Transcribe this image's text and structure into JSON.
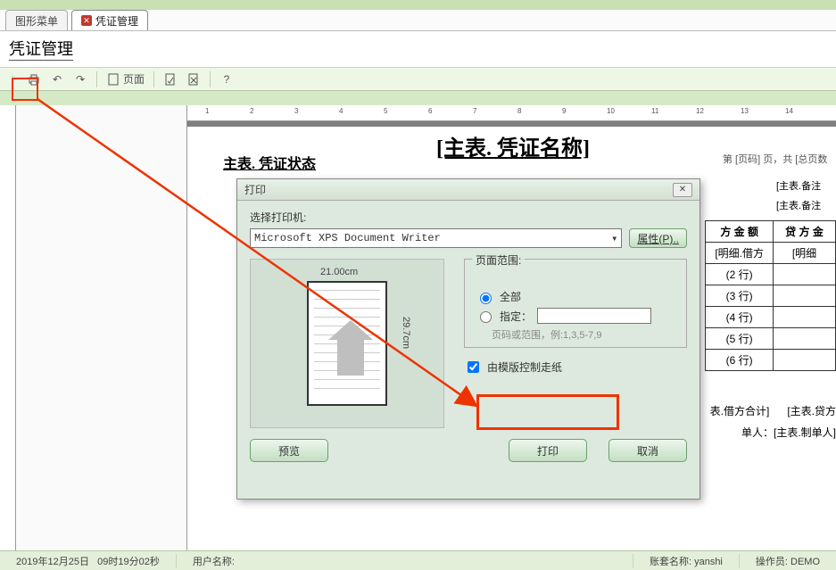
{
  "tabs": {
    "graphic_menu": "图形菜单",
    "voucher_mgmt": "凭证管理"
  },
  "page_title": "凭证管理",
  "toolbar": {
    "page_label": "页面"
  },
  "design": {
    "status_ph": "主表. 凭证状态",
    "title_ph": "[主表. 凭证名称]",
    "pager_ph": "第 [页码] 页，共 [总页数",
    "remark_ph": "[主表.备注",
    "remark2_ph": "[主表.备注",
    "col_debit": "方 金 额",
    "col_credit": "贷 方 金",
    "row_debit_detail": "[明细.借方",
    "row_credit_detail": "[明细",
    "rows": [
      "(2 行)",
      "(3 行)",
      "(4 行)",
      "(5 行)",
      "(6 行)"
    ],
    "sum_debit": "表.借方合计]",
    "sum_credit": "[主表.贷方",
    "maker": "单人：[主表.制单人]"
  },
  "print_dialog": {
    "title": "打印",
    "select_printer_label": "选择打印机:",
    "printer_name": "Microsoft XPS Document Writer",
    "properties_btn": "属性(P)..",
    "paper_width": "21.00cm",
    "paper_height": "29.7cm",
    "range_legend": "页面范围:",
    "opt_all": "全部",
    "opt_specify": "指定：",
    "range_hint": "页码或范围，例:1,3,5-7,9",
    "check_template": "由模版控制走纸",
    "btn_preview": "预览",
    "btn_print": "打印",
    "btn_cancel": "取消"
  },
  "status": {
    "date": "2019年12月25日",
    "time": "09时19分02秒",
    "user_label": "用户名称:",
    "acct_label": "账套名称:",
    "acct_value": "yanshi",
    "op_label": "操作员",
    "op_value": "DEMO"
  },
  "ruler_ticks": [
    "1",
    "2",
    "3",
    "4",
    "5",
    "6",
    "7",
    "8",
    "9",
    "10",
    "11",
    "12",
    "13",
    "14"
  ]
}
